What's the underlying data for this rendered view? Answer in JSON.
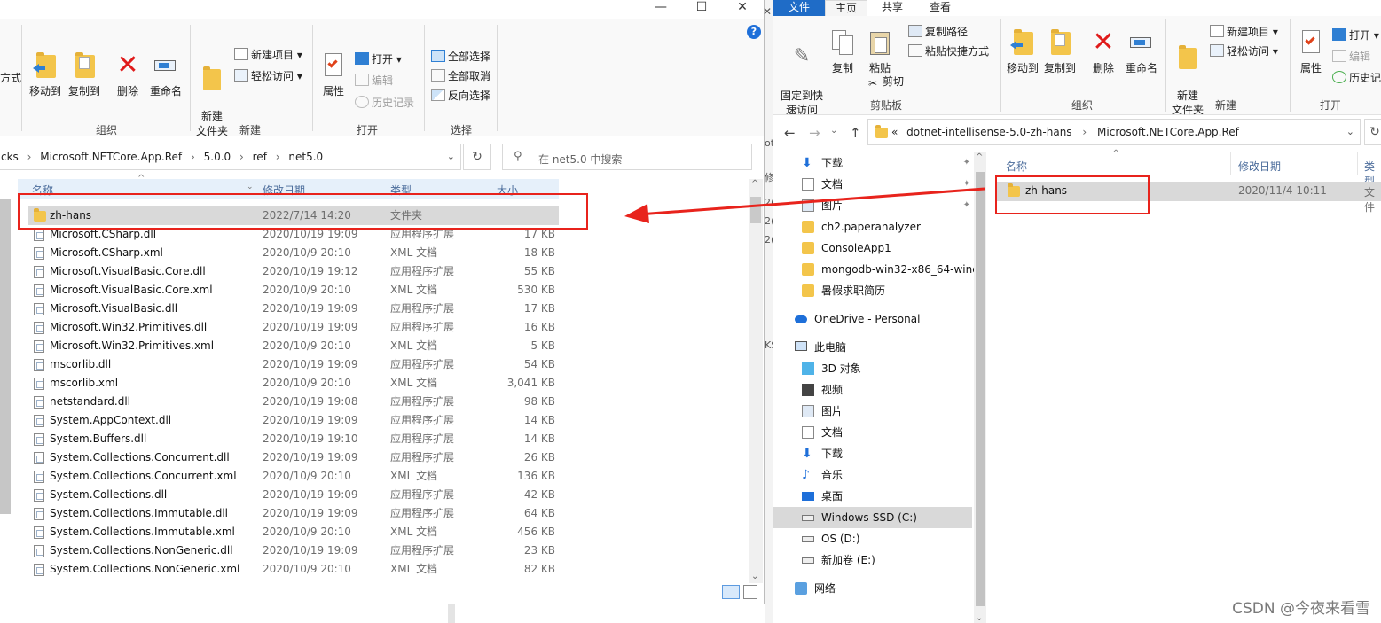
{
  "left": {
    "window_controls": {
      "minimize": "—",
      "maximize": "☐",
      "close": "✕",
      "help": "?"
    },
    "ribbon": {
      "cut_label": "方式",
      "move_to": "移动到",
      "copy_to": "复制到",
      "delete": "删除",
      "rename": "重命名",
      "new_folder": "新建\n文件夹",
      "new_item": "新建项目 ▾",
      "easy_access": "轻松访问 ▾",
      "properties": "属性",
      "open": "打开 ▾",
      "edit": "编辑",
      "history": "历史记录",
      "select_all": "全部选择",
      "select_none": "全部取消",
      "invert_selection": "反向选择",
      "groups": {
        "organize": "组织",
        "new": "新建",
        "open": "打开",
        "select": "选择"
      }
    },
    "address": {
      "crumbs": [
        "cks",
        "Microsoft.NETCore.App.Ref",
        "5.0.0",
        "ref",
        "net5.0"
      ],
      "separator": "›"
    },
    "search": {
      "placeholder": "在 net5.0 中搜索"
    },
    "columns": {
      "name": "名称",
      "date": "修改日期",
      "type": "类型",
      "size": "大小"
    },
    "files": [
      {
        "name": "zh-hans",
        "date": "2022/7/14 14:20",
        "type": "文件夹",
        "size": "",
        "folder": true
      },
      {
        "name": "Microsoft.CSharp.dll",
        "date": "2020/10/19 19:09",
        "type": "应用程序扩展",
        "size": "17 KB"
      },
      {
        "name": "Microsoft.CSharp.xml",
        "date": "2020/10/9 20:10",
        "type": "XML 文档",
        "size": "18 KB"
      },
      {
        "name": "Microsoft.VisualBasic.Core.dll",
        "date": "2020/10/19 19:12",
        "type": "应用程序扩展",
        "size": "55 KB"
      },
      {
        "name": "Microsoft.VisualBasic.Core.xml",
        "date": "2020/10/9 20:10",
        "type": "XML 文档",
        "size": "530 KB"
      },
      {
        "name": "Microsoft.VisualBasic.dll",
        "date": "2020/10/19 19:09",
        "type": "应用程序扩展",
        "size": "17 KB"
      },
      {
        "name": "Microsoft.Win32.Primitives.dll",
        "date": "2020/10/19 19:09",
        "type": "应用程序扩展",
        "size": "16 KB"
      },
      {
        "name": "Microsoft.Win32.Primitives.xml",
        "date": "2020/10/9 20:10",
        "type": "XML 文档",
        "size": "5 KB"
      },
      {
        "name": "mscorlib.dll",
        "date": "2020/10/19 19:09",
        "type": "应用程序扩展",
        "size": "54 KB"
      },
      {
        "name": "mscorlib.xml",
        "date": "2020/10/9 20:10",
        "type": "XML 文档",
        "size": "3,041 KB"
      },
      {
        "name": "netstandard.dll",
        "date": "2020/10/19 19:08",
        "type": "应用程序扩展",
        "size": "98 KB"
      },
      {
        "name": "System.AppContext.dll",
        "date": "2020/10/19 19:09",
        "type": "应用程序扩展",
        "size": "14 KB"
      },
      {
        "name": "System.Buffers.dll",
        "date": "2020/10/19 19:10",
        "type": "应用程序扩展",
        "size": "14 KB"
      },
      {
        "name": "System.Collections.Concurrent.dll",
        "date": "2020/10/19 19:09",
        "type": "应用程序扩展",
        "size": "26 KB"
      },
      {
        "name": "System.Collections.Concurrent.xml",
        "date": "2020/10/9 20:10",
        "type": "XML 文档",
        "size": "136 KB"
      },
      {
        "name": "System.Collections.dll",
        "date": "2020/10/19 19:09",
        "type": "应用程序扩展",
        "size": "42 KB"
      },
      {
        "name": "System.Collections.Immutable.dll",
        "date": "2020/10/19 19:09",
        "type": "应用程序扩展",
        "size": "64 KB"
      },
      {
        "name": "System.Collections.Immutable.xml",
        "date": "2020/10/9 20:10",
        "type": "XML 文档",
        "size": "456 KB"
      },
      {
        "name": "System.Collections.NonGeneric.dll",
        "date": "2020/10/19 19:09",
        "type": "应用程序扩展",
        "size": "23 KB"
      },
      {
        "name": "System.Collections.NonGeneric.xml",
        "date": "2020/10/9 20:10",
        "type": "XML 文档",
        "size": "82 KB"
      }
    ]
  },
  "right": {
    "tabs": [
      "文件",
      "主页",
      "共享",
      "查看"
    ],
    "ribbon": {
      "pin_quick_access": "固定到快\n速访问",
      "copy": "复制",
      "paste": "粘贴",
      "copy_path": "复制路径",
      "paste_shortcut": "粘贴快捷方式",
      "cut": "剪切",
      "move_to": "移动到",
      "copy_to": "复制到",
      "delete": "删除",
      "rename": "重命名",
      "new_folder": "新建\n文件夹",
      "new_item": "新建项目 ▾",
      "easy_access": "轻松访问 ▾",
      "properties": "属性",
      "open": "打开 ▾",
      "edit": "编辑",
      "history": "历史记",
      "groups": {
        "clipboard": "剪贴板",
        "organize": "组织",
        "new": "新建",
        "open": "打开"
      }
    },
    "address": {
      "prefix": "«",
      "crumbs": [
        "dotnet-intellisense-5.0-zh-hans",
        "Microsoft.NETCore.App.Ref"
      ],
      "separator": "›"
    },
    "nav": [
      {
        "label": "下载",
        "icon": "download-icon",
        "pinned": true
      },
      {
        "label": "文档",
        "icon": "document-icon",
        "pinned": true
      },
      {
        "label": "图片",
        "icon": "picture-icon",
        "pinned": true
      },
      {
        "label": "ch2.paperanalyzer",
        "icon": "folder-icon"
      },
      {
        "label": "ConsoleApp1",
        "icon": "folder-icon"
      },
      {
        "label": "mongodb-win32-x86_64-wind",
        "icon": "folder-icon"
      },
      {
        "label": "暑假求职简历",
        "icon": "folder-icon"
      },
      {
        "label": "OneDrive - Personal",
        "icon": "cloud-icon",
        "section": true
      },
      {
        "label": "此电脑",
        "icon": "computer-icon",
        "section": true
      },
      {
        "label": "3D 对象",
        "icon": "cube-icon"
      },
      {
        "label": "视频",
        "icon": "video-icon"
      },
      {
        "label": "图片",
        "icon": "picture-icon"
      },
      {
        "label": "文档",
        "icon": "document-icon"
      },
      {
        "label": "下载",
        "icon": "download-icon"
      },
      {
        "label": "音乐",
        "icon": "music-icon"
      },
      {
        "label": "桌面",
        "icon": "desktop-icon"
      },
      {
        "label": "Windows-SSD (C:)",
        "icon": "drive-icon",
        "selected": true
      },
      {
        "label": "OS (D:)",
        "icon": "drive-icon"
      },
      {
        "label": "新加卷 (E:)",
        "icon": "drive-icon"
      },
      {
        "label": "网络",
        "icon": "network-icon",
        "section": true
      }
    ],
    "columns": {
      "name": "名称",
      "date": "修改日期",
      "type": "类型"
    },
    "files": [
      {
        "name": "zh-hans",
        "date": "2020/11/4 10:11",
        "type": "文件"
      }
    ]
  },
  "between": {
    "frag1": "otr",
    "frag2": "2(",
    "frag3": "2(",
    "frag4": "2(",
    "frag5": "KS",
    "frag6": "修"
  },
  "watermark": "CSDN @今夜来看雪",
  "colors": {
    "annotation_red": "#e8231c",
    "folder_yellow": "#f3c54b",
    "selection_gray": "#d9d9d9",
    "nav_selected": "#cce8ff"
  }
}
